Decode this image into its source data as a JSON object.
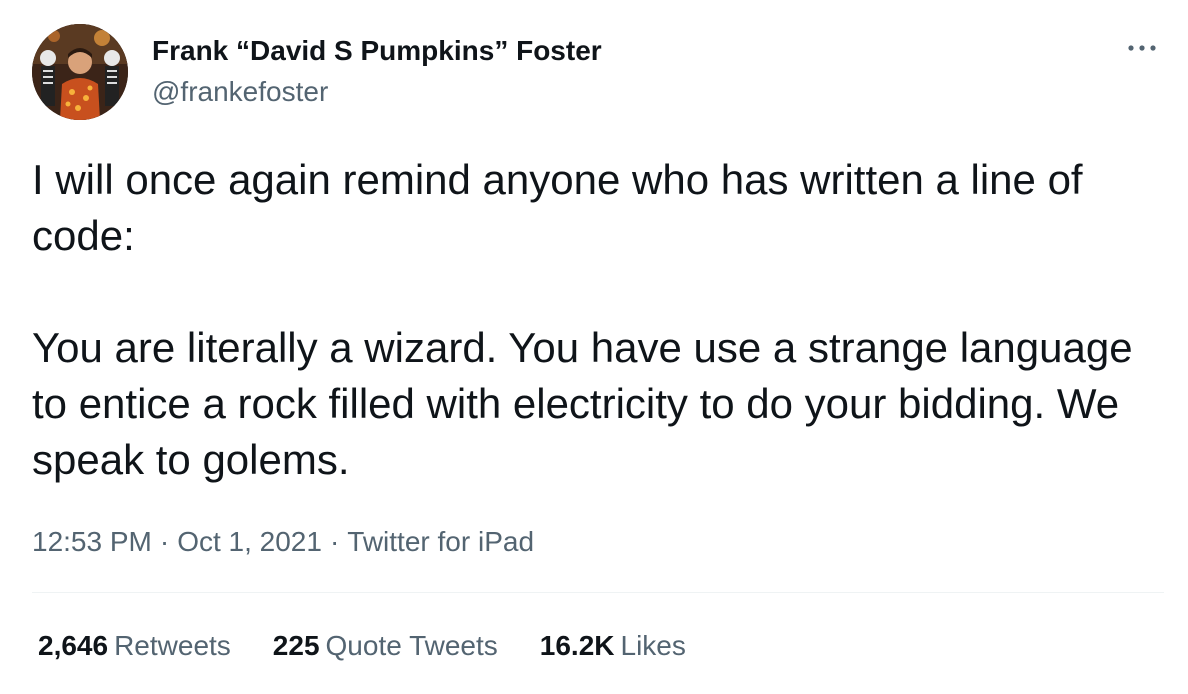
{
  "author": {
    "display_name": "Frank “David S Pumpkins” Foster",
    "handle": "@frankefoster",
    "avatar": "profile-photo"
  },
  "more_icon": "ellipsis-icon",
  "tweet": {
    "paragraph_1": "I will once again remind anyone who has written a line of code:",
    "paragraph_2": "You are literally a wizard. You have use a strange language to entice a rock filled with electricity to do your bidding. We speak to golems."
  },
  "meta": {
    "time": "12:53 PM",
    "separator": "·",
    "date": "Oct 1, 2021",
    "source": "Twitter for iPad"
  },
  "stats": {
    "retweets_count": "2,646",
    "retweets_label": "Retweets",
    "quotes_count": "225",
    "quotes_label": "Quote Tweets",
    "likes_count": "16.2K",
    "likes_label": "Likes"
  },
  "colors": {
    "primary_text": "#0f1419",
    "secondary_text": "#536471",
    "divider": "#eff3f4"
  }
}
